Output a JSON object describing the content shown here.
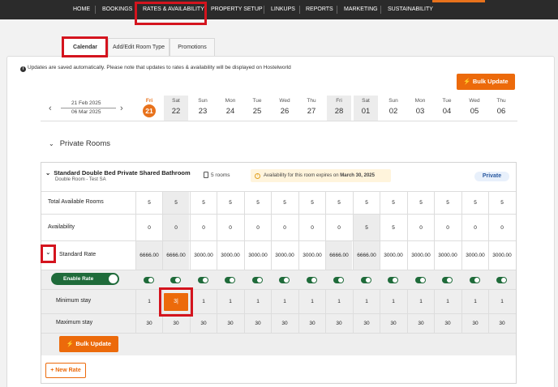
{
  "nav": {
    "items": [
      "HOME",
      "BOOKINGS",
      "RATES & AVAILABILITY",
      "PROPERTY SETUP",
      "LINKUPS",
      "REPORTS",
      "MARKETING",
      "SUSTAINABILITY"
    ]
  },
  "tabs": [
    "Calendar",
    "Add/Edit Room Type",
    "Promotions"
  ],
  "notice": "Updates are saved automatically. Please note that updates to rates & availability will be displayed on Hostelworld",
  "bulk_update_top": "Bulk Update",
  "date_range": {
    "from": "21 Feb 2025",
    "to": "06 Mar 2025"
  },
  "days": [
    {
      "dow": "Fri",
      "date": "21"
    },
    {
      "dow": "Sat",
      "date": "22"
    },
    {
      "dow": "Sun",
      "date": "23"
    },
    {
      "dow": "Mon",
      "date": "24"
    },
    {
      "dow": "Tue",
      "date": "25"
    },
    {
      "dow": "Wed",
      "date": "26"
    },
    {
      "dow": "Thu",
      "date": "27"
    },
    {
      "dow": "Fri",
      "date": "28"
    },
    {
      "dow": "Sat",
      "date": "01"
    },
    {
      "dow": "Sun",
      "date": "02"
    },
    {
      "dow": "Mon",
      "date": "03"
    },
    {
      "dow": "Tue",
      "date": "04"
    },
    {
      "dow": "Wed",
      "date": "05"
    },
    {
      "dow": "Thu",
      "date": "06"
    }
  ],
  "section_title": "Private Rooms",
  "room": {
    "name": "Standard Double Bed Private Shared Bathroom",
    "subtitle": "Double Room - Test SA",
    "rooms_count": "5 rooms",
    "availability_notice": "Availability for this room expires on",
    "availability_date": "March 30, 2025",
    "badge": "Private"
  },
  "rows": {
    "total_available_label": "Total Available Rooms",
    "total_available": [
      "5",
      "5",
      "5",
      "5",
      "5",
      "5",
      "5",
      "5",
      "5",
      "5",
      "5",
      "5",
      "5",
      "5"
    ],
    "availability_label": "Availability",
    "availability": [
      "0",
      "0",
      "0",
      "0",
      "0",
      "0",
      "0",
      "0",
      "5",
      "5",
      "0",
      "0",
      "0",
      "0"
    ],
    "standard_rate_label": "Standard Rate",
    "standard_rate": [
      "6666.00",
      "6666.00",
      "3000.00",
      "3000.00",
      "3000.00",
      "3000.00",
      "3000.00",
      "6666.00",
      "6666.00",
      "3000.00",
      "3000.00",
      "3000.00",
      "3000.00",
      "3000.00"
    ],
    "enable_rate_label": "Enable Rate",
    "min_stay_label": "Minimum stay",
    "min_stay": [
      "1",
      "3|",
      "1",
      "1",
      "1",
      "1",
      "1",
      "1",
      "1",
      "1",
      "1",
      "1",
      "1",
      "1"
    ],
    "max_stay_label": "Maximum stay",
    "max_stay": [
      "30",
      "30",
      "30",
      "30",
      "30",
      "30",
      "30",
      "30",
      "30",
      "30",
      "30",
      "30",
      "30",
      "30"
    ]
  },
  "bulk_update_bottom": "Bulk Update",
  "new_rate": "+ New Rate",
  "colors": {
    "accent": "#ec6a0b",
    "toggle": "#1f6b3a",
    "highlight": "#d4141e"
  }
}
